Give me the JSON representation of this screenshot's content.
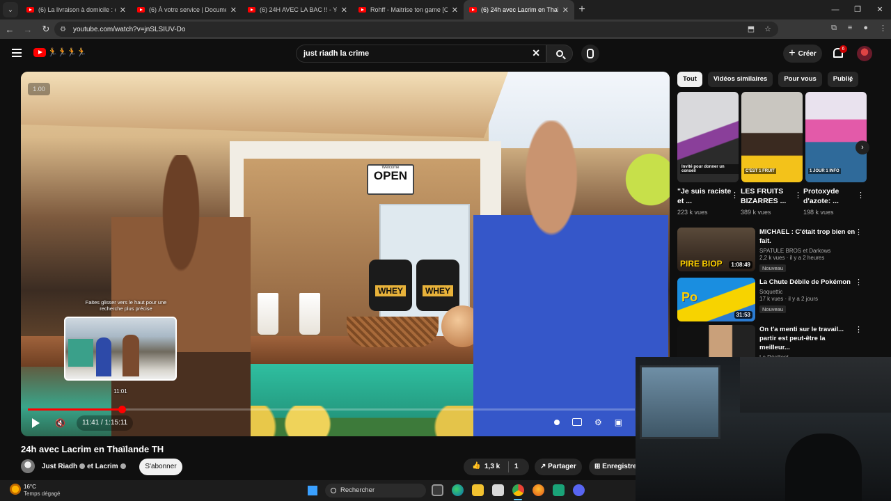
{
  "browser": {
    "tabs": [
      {
        "title": "(6) La livraison à domicile : de l'"
      },
      {
        "title": "(6) À votre service | Documenta"
      },
      {
        "title": "(6) 24H AVEC LA BAC !! - YouTu"
      },
      {
        "title": "Rohff - Maitrise ton game [Clip"
      },
      {
        "title": "(6) 24h avec Lacrim en Thaïlan",
        "active": true
      }
    ],
    "url": "youtube.com/watch?v=jnSLSIUV-Do"
  },
  "youtube": {
    "search_query": "just riadh la crime",
    "create_label": "Créer",
    "notifications": "6"
  },
  "player": {
    "speed": "1.00",
    "hint": "Faites glisser vers le haut pour une recherche plus précise",
    "preview_time": "11:01",
    "time_display": "11:41 / 1:15:11",
    "progress_fraction": 0.155,
    "sign_small": "Welcome",
    "sign_big": "OPEN",
    "product_label": "WHEY"
  },
  "video": {
    "title": "24h avec Lacrim en Thaïlande TH",
    "channels": [
      "Just Riadh",
      "et Lacrim"
    ],
    "subscribe_label": "S'abonner",
    "likes": "1,3 k",
    "dislikes": "1",
    "share_label": "Partager",
    "save_label": "Enregistrer"
  },
  "sidebar": {
    "chips": [
      "Tout",
      "Vidéos similaires",
      "Pour vous",
      "Publié"
    ],
    "shorts": [
      {
        "title": "\"Je suis raciste et ...",
        "views": "223 k vues",
        "caption": "Invité pour donner un conseil"
      },
      {
        "title": "LES FRUITS BIZARRES ...",
        "views": "389 k vues",
        "caption": "C'EST 1 FRUIT"
      },
      {
        "title": "Protoxyde d'azote: ...",
        "views": "198 k vues",
        "caption": "1 JOUR 1 INFO"
      }
    ],
    "recommendations": [
      {
        "title": "MICHAEL : C'était trop bien en fait.",
        "channel": "SPATULE BROS et Darkows",
        "meta": "2,2 k vues · il y a 2 heures",
        "badge": "Nouveau",
        "duration": "1:08:49",
        "thumb_text": "PIRE BIOP"
      },
      {
        "title": "La Chute Débile de Pokémon",
        "channel": "Soquettic",
        "meta": "17 k vues · il y a 2 jours",
        "badge": "Nouveau",
        "duration": "31:53",
        "thumb_text": "Po"
      },
      {
        "title": "On t'a menti sur le travail... partir est peut-être la meilleur...",
        "channel": "Le Résilient",
        "meta": "",
        "badge": "",
        "duration": "",
        "thumb_text": ""
      }
    ]
  },
  "taskbar": {
    "temperature": "16°C",
    "weather": "Temps dégagé",
    "search_label": "Rechercher"
  }
}
